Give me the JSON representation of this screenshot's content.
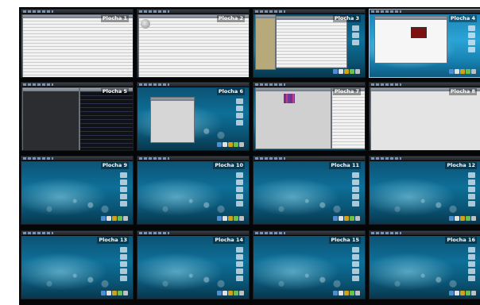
{
  "workspace_switcher": {
    "desktops": [
      {
        "label": "Plocha 1"
      },
      {
        "label": "Plocha 2"
      },
      {
        "label": "Plocha 3"
      },
      {
        "label": "Plocha 4"
      },
      {
        "label": "Plocha 5"
      },
      {
        "label": "Plocha 6"
      },
      {
        "label": "Plocha 7"
      },
      {
        "label": "Plocha 8"
      },
      {
        "label": "Plocha 9"
      },
      {
        "label": "Plocha 10"
      },
      {
        "label": "Plocha 11"
      },
      {
        "label": "Plocha 12"
      },
      {
        "label": "Plocha 13"
      },
      {
        "label": "Plocha 14"
      },
      {
        "label": "Plocha 15"
      },
      {
        "label": "Plocha 16"
      }
    ],
    "active_desktop": "Plocha 4",
    "colors": {
      "background": "#050608",
      "wallpaper": "#0e6f98",
      "active_border": "#9fc6e8"
    }
  }
}
